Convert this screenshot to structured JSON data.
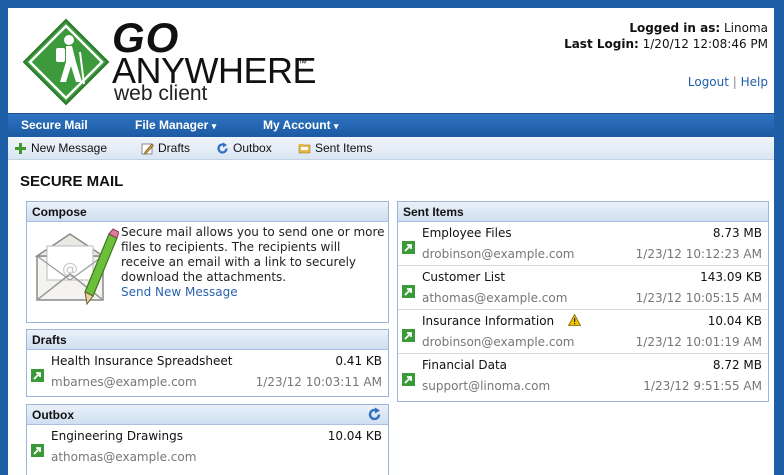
{
  "logo": {
    "line1": "GO",
    "line2": "ANYWHERE",
    "tm": "™",
    "line3": "web client"
  },
  "user": {
    "logged_label": "Logged in as:",
    "logged_value": " Linoma",
    "last_label": "Last Login:",
    "last_value": " 1/20/12 12:08:46 PM"
  },
  "header_links": {
    "logout": "Logout",
    "sep": " | ",
    "help": "Help"
  },
  "nav": {
    "secure_mail": "Secure Mail",
    "file_manager": "File Manager",
    "my_account": "My Account",
    "arrow": "▾"
  },
  "toolbar": {
    "new_message": "New Message",
    "drafts": "Drafts",
    "outbox": "Outbox",
    "sent_items": "Sent Items"
  },
  "page_title": "SECURE MAIL",
  "compose": {
    "title": "Compose",
    "text": "Secure mail allows you to send one or more files to recipients. The recipients will receive an email with a link to securely download the attachments.",
    "link": "Send New Message"
  },
  "drafts": {
    "title": "Drafts",
    "items": [
      {
        "name": "Health Insurance Spreadsheet",
        "size": "0.41 KB",
        "from": "mbarnes@example.com",
        "date": "1/23/12 10:03:11 AM"
      }
    ]
  },
  "outbox": {
    "title": "Outbox",
    "items": [
      {
        "name": "Engineering Drawings",
        "size": "10.04 KB",
        "from": "athomas@example.com",
        "date": ""
      }
    ]
  },
  "sent": {
    "title": "Sent Items",
    "items": [
      {
        "name": "Employee Files",
        "size": "8.73 MB",
        "from": "drobinson@example.com",
        "date": "1/23/12 10:12:23 AM"
      },
      {
        "name": "Customer List",
        "size": "143.09 KB",
        "from": "athomas@example.com",
        "date": "1/23/12 10:05:15 AM"
      },
      {
        "name": "Insurance Information",
        "size": "10.04 KB",
        "from": "drobinson@example.com",
        "date": "1/23/12 10:01:19 AM",
        "warning": true
      },
      {
        "name": "Financial Data",
        "size": "8.72 MB",
        "from": "support@linoma.com",
        "date": "1/23/12 9:51:55 AM"
      }
    ]
  },
  "colors": {
    "frame": "#1d5ea6",
    "nav": "#2f74c2",
    "accent_green": "#3c8f3c",
    "link": "#2b62ad"
  }
}
